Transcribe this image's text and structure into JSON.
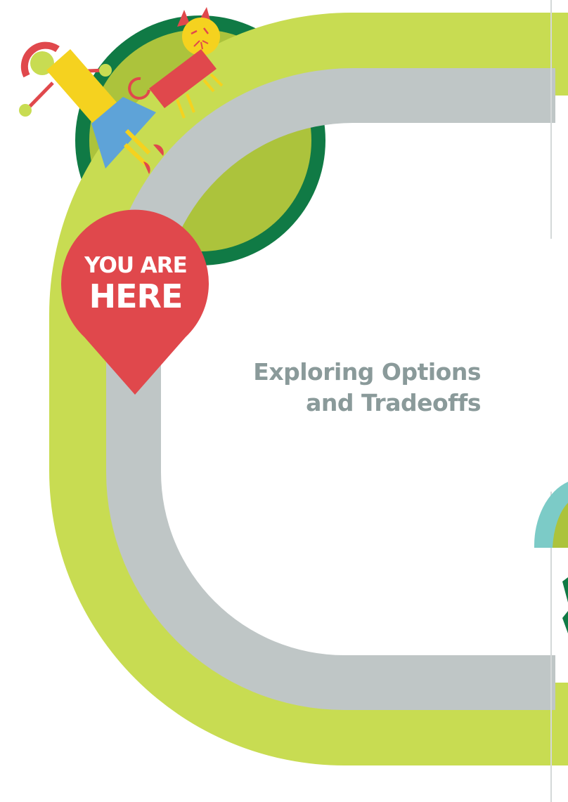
{
  "pin": {
    "line1": "YOU ARE",
    "line2": "HERE"
  },
  "title": {
    "line1": "Exploring Options",
    "line2": "and Tradeoffs"
  },
  "colors": {
    "outer_track": "#c8dc52",
    "inner_track": "#bfc6c6",
    "pin": "#e0484c",
    "title_text": "#8a9a9a",
    "dark_green": "#107a45",
    "olive": "#acc33c",
    "yellow": "#f5d21f",
    "red": "#e0484c",
    "blue": "#5ea3d8",
    "teal": "#7ccbc7"
  }
}
